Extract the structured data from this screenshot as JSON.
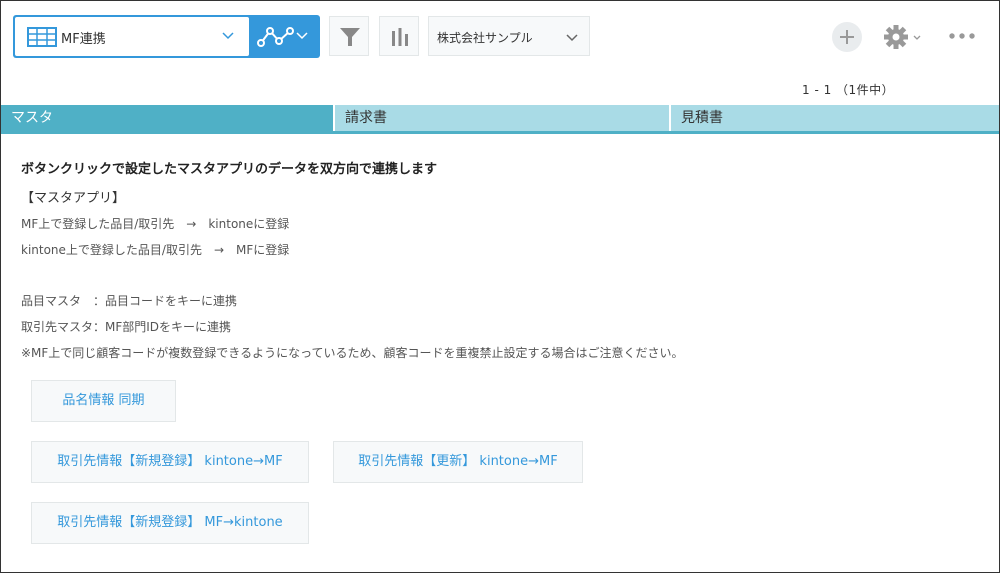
{
  "toolbar": {
    "view_label": "MF連携",
    "company_label": "株式会社サンプル"
  },
  "pager": "1 - 1 （1件中）",
  "tabs": [
    {
      "label": "マスタ",
      "active": true
    },
    {
      "label": "請求書",
      "active": false
    },
    {
      "label": "見積書",
      "active": false
    }
  ],
  "content": {
    "heading": "ボタンクリックで設定したマスタアプリのデータを双方向で連携します",
    "subheading": "【マスタアプリ】",
    "lines": [
      "MF上で登録した品目/取引先　→　kintoneに登録",
      "kintone上で登録した品目/取引先　→　MFに登録",
      "品目マスタ　：品目コードをキーに連携",
      "取引先マスタ：MF部門IDをキーに連携",
      "※MF上で同じ顧客コードが複数登録できるようになっているため、顧客コードを重複禁止設定する場合はご注意ください。"
    ]
  },
  "buttons": {
    "sync_items": "品名情報 同期",
    "client_new_to_mf": "取引先情報【新規登録】 kintone→MF",
    "client_update_to_mf": "取引先情報【更新】 kintone→MF",
    "client_new_to_kintone": "取引先情報【新規登録】 MF→kintone"
  },
  "colors": {
    "accent": "#3498db",
    "tab_active": "#4fb0c6",
    "tab_inactive": "#a9dbe6"
  }
}
